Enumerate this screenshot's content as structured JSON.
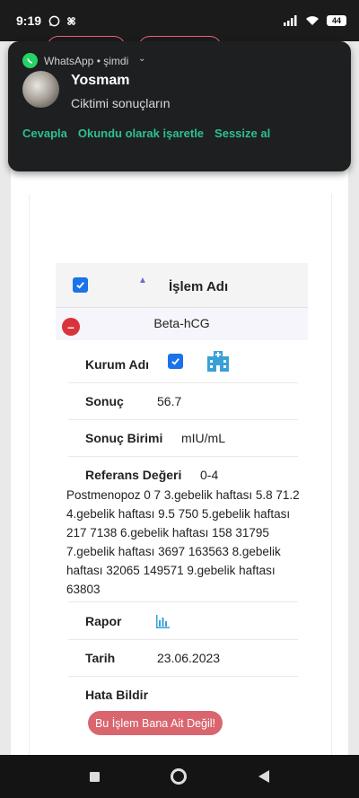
{
  "status_bar": {
    "time": "9:19",
    "battery": "44"
  },
  "notification": {
    "app_name": "WhatsApp • şimdi",
    "sender": "Yosmam",
    "message": "Ciktimi sonuçların",
    "actions": [
      "Cevapla",
      "Okundu olarak işaretle",
      "Sessize al"
    ]
  },
  "table": {
    "header_label": "İşlem Adı",
    "row_name": "Beta-hCG",
    "fields": {
      "kurum_label": "Kurum Adı",
      "sonuc_label": "Sonuç",
      "sonuc_value": "56.7",
      "birim_label": "Sonuç Birimi",
      "birim_value": "mIU/mL",
      "referans_label": "Referans Değeri",
      "referans_value": "0-4",
      "referans_text": "Postmenopoz 0 7 3.gebelik haftası 5.8 71.2 4.gebelik haftası 9.5 750 5.gebelik haftası 217 7138 6.gebelik haftası 158 31795 7.gebelik haftası 3697 163563 8.gebelik haftası 32065 149571 9.gebelik haftası 63803",
      "rapor_label": "Rapor",
      "tarih_label": "Tarih",
      "tarih_value": "23.06.2023",
      "hata_label": "Hata Bildir",
      "hata_button": "Bu İşlem Bana Ait Değil!"
    }
  },
  "colors": {
    "accent": "#1a73e8",
    "danger": "#d9343b",
    "whatsapp": "#25d366",
    "action_green": "#2ec08f"
  }
}
